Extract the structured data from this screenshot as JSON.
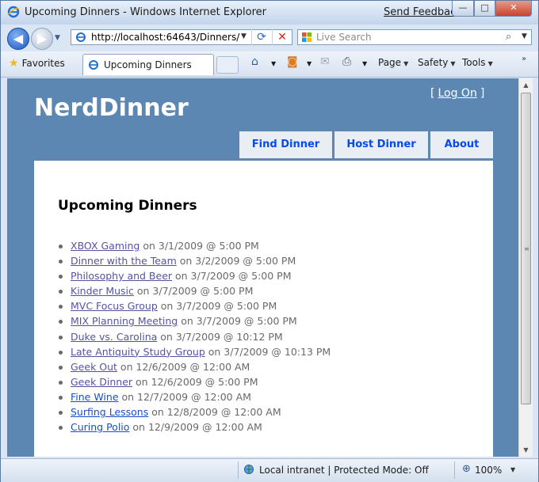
{
  "window": {
    "title": "Upcoming Dinners - Windows Internet Explorer",
    "send_feedback": "Send Feedback",
    "minimize": "—",
    "maximize": "□",
    "close": "✕"
  },
  "nav": {
    "back_glyph": "◀",
    "forward_glyph": "▶",
    "dropdown_glyph": "▼"
  },
  "address": {
    "url": "http://localhost:64643/Dinners/",
    "refresh_glyph": "⟳",
    "stop_glyph": "✕"
  },
  "search": {
    "placeholder": "Live Search",
    "search_glyph": "⌕"
  },
  "toolbar": {
    "favorites": "Favorites",
    "tab_label": "Upcoming Dinners",
    "home_glyph": "⌂",
    "feeds_glyph": "◙",
    "mail_glyph": "✉",
    "print_glyph": "⎙",
    "page": "Page",
    "safety": "Safety",
    "tools": "Tools",
    "more_glyph": "»"
  },
  "site": {
    "title": "NerdDinner",
    "logon_open": "[",
    "logon": "Log On",
    "logon_close": "]",
    "menu": {
      "find": "Find Dinner",
      "host": "Host Dinner",
      "about": "About"
    },
    "page_title": "Upcoming Dinners",
    "dinners": [
      {
        "title": "XBOX Gaming",
        "when": " on 3/1/2009 @ 5:00 PM",
        "visited": true
      },
      {
        "title": "Dinner with the Team",
        "when": " on 3/2/2009 @ 5:00 PM",
        "visited": true
      },
      {
        "title": "Philosophy and Beer",
        "when": " on 3/7/2009 @ 5:00 PM",
        "visited": true
      },
      {
        "title": "Kinder Music",
        "when": " on 3/7/2009 @ 5:00 PM",
        "visited": true
      },
      {
        "title": "MVC Focus Group",
        "when": " on 3/7/2009 @ 5:00 PM",
        "visited": true
      },
      {
        "title": "MIX Planning Meeting",
        "when": " on 3/7/2009 @ 5:00 PM",
        "visited": true
      },
      {
        "title": "Duke vs. Carolina",
        "when": " on 3/7/2009 @ 10:12 PM",
        "visited": true
      },
      {
        "title": "Late Antiquity Study Group",
        "when": " on 3/7/2009 @ 10:13 PM",
        "visited": true
      },
      {
        "title": "Geek Out",
        "when": " on 12/6/2009 @ 12:00 AM",
        "visited": true
      },
      {
        "title": "Geek Dinner",
        "when": " on 12/6/2009 @ 5:00 PM",
        "visited": true
      },
      {
        "title": "Fine Wine",
        "when": " on 12/7/2009 @ 12:00 AM",
        "visited": false
      },
      {
        "title": "Surfing Lessons",
        "when": " on 12/8/2009 @ 12:00 AM",
        "visited": false
      },
      {
        "title": "Curing Polio",
        "when": " on 12/9/2009 @ 12:00 AM",
        "visited": false
      }
    ]
  },
  "status": {
    "zone": "Local intranet | Protected Mode: Off",
    "zoom": "100%"
  },
  "colors": {
    "site_background": "#5c87b2",
    "menu_link": "#034af3",
    "visited_link": "#5553a0",
    "unvisited_link": "#1a4ec9"
  }
}
